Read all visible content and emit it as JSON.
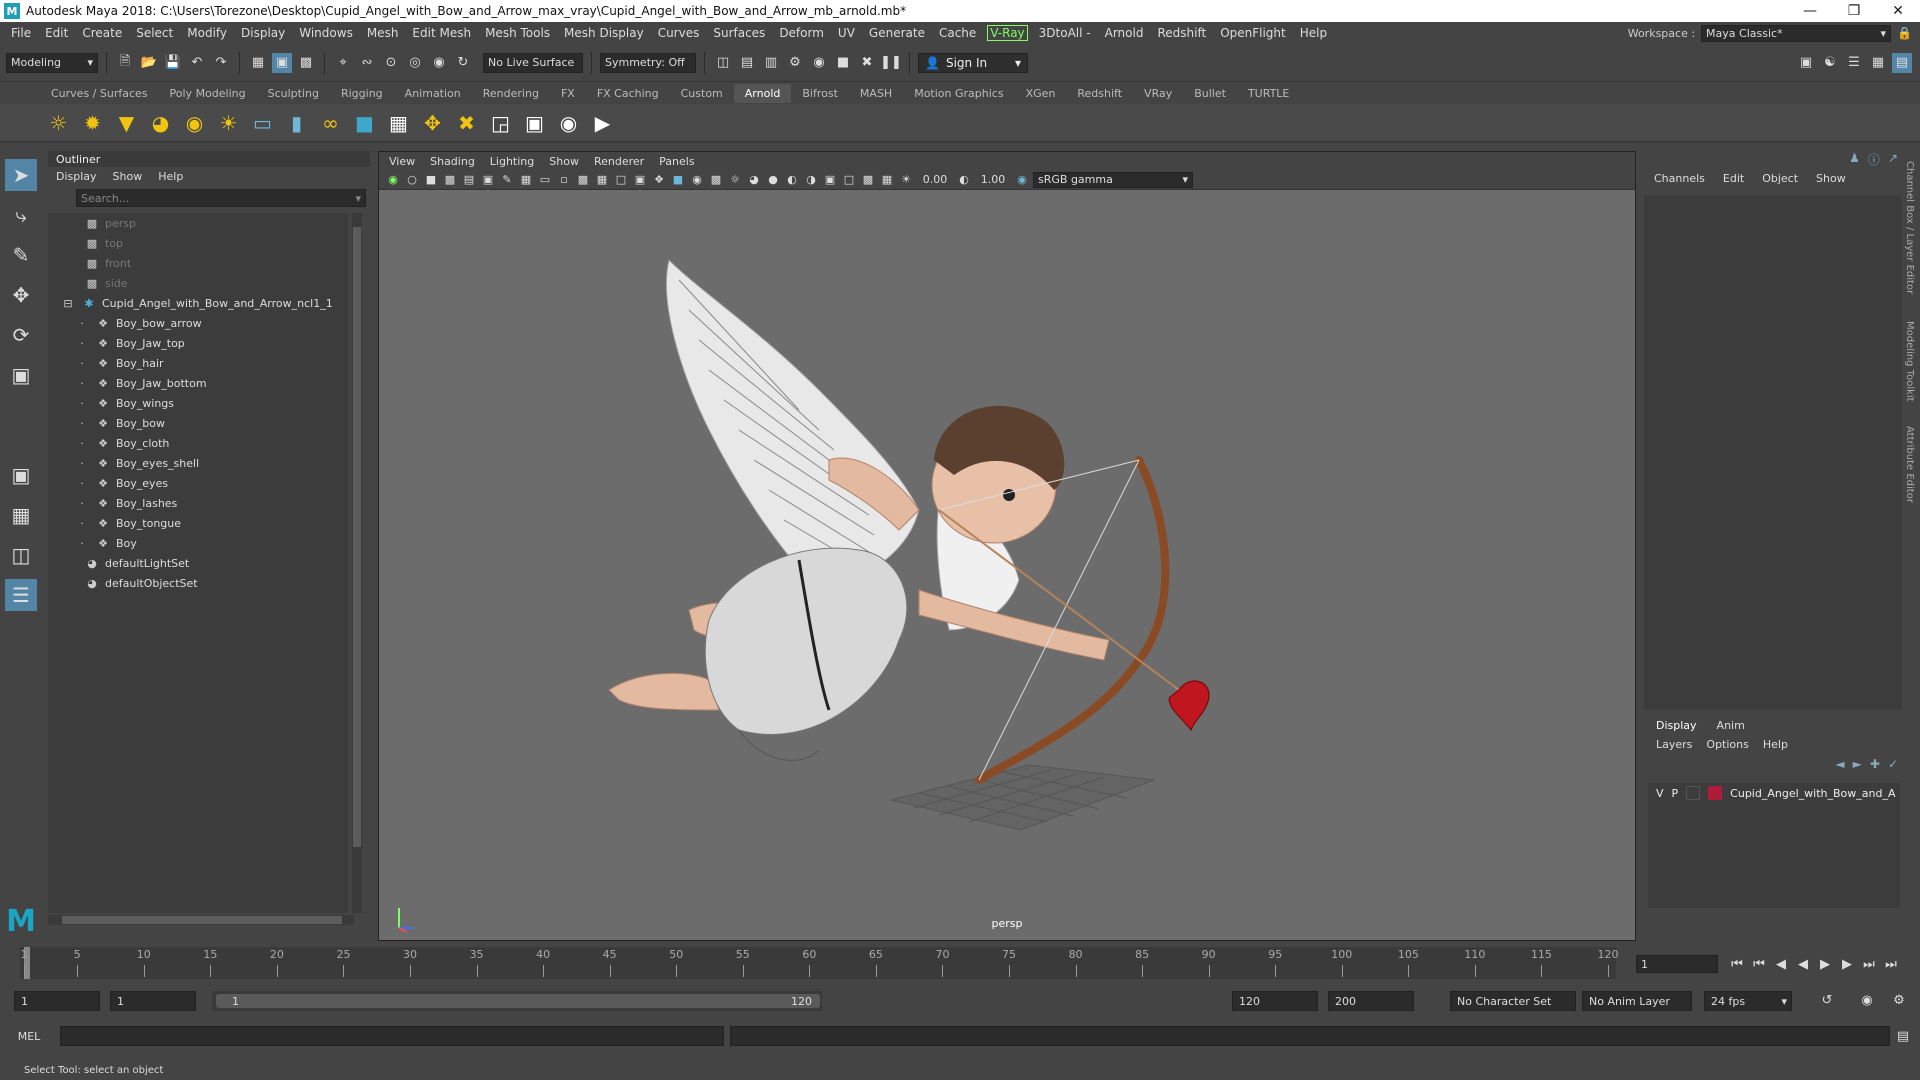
{
  "window": {
    "title": "Autodesk Maya 2018: C:\\Users\\Torezone\\Desktop\\Cupid_Angel_with_Bow_and_Arrow_max_vray\\Cupid_Angel_with_Bow_and_Arrow_mb_arnold.mb*",
    "logo": "M"
  },
  "menubar": {
    "items": [
      "File",
      "Edit",
      "Create",
      "Select",
      "Modify",
      "Display",
      "Windows",
      "Mesh",
      "Edit Mesh",
      "Mesh Tools",
      "Mesh Display",
      "Curves",
      "Surfaces",
      "Deform",
      "UV",
      "Generate",
      "Cache"
    ],
    "vray": "V-Ray",
    "items2": [
      "3DtoAll -",
      "Arnold",
      "Redshift",
      "OpenFlight",
      "Help"
    ],
    "workspace_label": "Workspace :",
    "workspace_value": "Maya Classic*"
  },
  "statusline": {
    "mode": "Modeling",
    "live_surface": "No Live Surface",
    "symmetry": "Symmetry: Off",
    "signin": "Sign In"
  },
  "shelf_tabs": [
    "Curves / Surfaces",
    "Poly Modeling",
    "Sculpting",
    "Rigging",
    "Animation",
    "Rendering",
    "FX",
    "FX Caching",
    "Custom",
    "Arnold",
    "Bifrost",
    "MASH",
    "Motion Graphics",
    "XGen",
    "Redshift",
    "VRay",
    "Bullet",
    "TURTLE"
  ],
  "active_shelf_tab": "Arnold",
  "outliner": {
    "title": "Outliner",
    "menu": [
      "Display",
      "Show",
      "Help"
    ],
    "search_placeholder": "Search...",
    "cameras": [
      "persp",
      "top",
      "front",
      "side"
    ],
    "group": "Cupid_Angel_with_Bow_and_Arrow_ncl1_1",
    "children": [
      "Boy_bow_arrow",
      "Boy_Jaw_top",
      "Boy_hair",
      "Boy_Jaw_bottom",
      "Boy_wings",
      "Boy_bow",
      "Boy_cloth",
      "Boy_eyes_shell",
      "Boy_eyes",
      "Boy_lashes",
      "Boy_tongue",
      "Boy"
    ],
    "sets": [
      "defaultLightSet",
      "defaultObjectSet"
    ]
  },
  "viewport": {
    "menu": [
      "View",
      "Shading",
      "Lighting",
      "Show",
      "Renderer",
      "Panels"
    ],
    "exposure": "0.00",
    "gamma_value": "1.00",
    "color_space": "sRGB gamma",
    "camera": "persp"
  },
  "channelbox": {
    "menu": [
      "Channels",
      "Edit",
      "Object",
      "Show"
    ]
  },
  "layers": {
    "tabs": [
      "Display",
      "Anim"
    ],
    "menu": [
      "Layers",
      "Options",
      "Help"
    ],
    "layer_v": "V",
    "layer_p": "P",
    "layer_name": "Cupid_Angel_with_Bow_and_A",
    "layer_color": "#b01b3a"
  },
  "side_tabs": [
    "Channel Box / Layer Editor",
    "Modeling Toolkit",
    "Attribute Editor"
  ],
  "timeslider": {
    "ticks": [
      "1",
      "5",
      "10",
      "15",
      "20",
      "25",
      "30",
      "35",
      "40",
      "45",
      "50",
      "55",
      "60",
      "65",
      "70",
      "75",
      "80",
      "85",
      "90",
      "95",
      "100",
      "105",
      "110",
      "115",
      "120"
    ],
    "current_frame": "1"
  },
  "range": {
    "start": "1",
    "anim_start": "1",
    "slider_start": "1",
    "slider_end": "120",
    "end": "120",
    "anim_end": "200",
    "character_set": "No Character Set",
    "anim_layer": "No Anim Layer",
    "fps": "24 fps"
  },
  "cmd": {
    "label": "MEL"
  },
  "help": {
    "text": "Select Tool: select an object"
  }
}
